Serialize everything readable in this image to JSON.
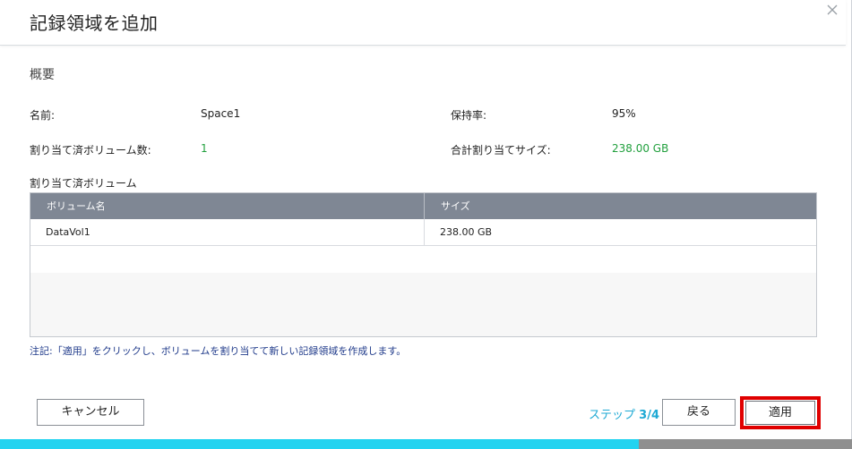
{
  "dialog": {
    "title": "記録領域を追加",
    "close_icon": "close-icon"
  },
  "summary": {
    "section_title": "概要",
    "name_label": "名前:",
    "name_value": "Space1",
    "retention_label": "保持率:",
    "retention_value": "95%",
    "volume_count_label": "割り当て済ボリューム数:",
    "volume_count_value": "1",
    "total_size_label": "合計割り当てサイズ:",
    "total_size_value": "238.00 GB",
    "accent_green": "#22a03e"
  },
  "volumes": {
    "subtitle": "割り当て済ボリューム",
    "columns": [
      "ボリューム名",
      "サイズ"
    ],
    "rows": [
      {
        "name": "DataVol1",
        "size": "238.00 GB"
      }
    ]
  },
  "note": "注記:「適用」をクリックし、ボリュームを割り当てて新しい記録領域を作成します。",
  "footer": {
    "cancel_label": "キャンセル",
    "step_prefix": "ステップ",
    "step_value": "3/4",
    "back_label": "戻る",
    "apply_label": "適用",
    "progress_fraction": 0.75,
    "progress_color": "#23d3f0",
    "highlight_color": "#e00000"
  }
}
